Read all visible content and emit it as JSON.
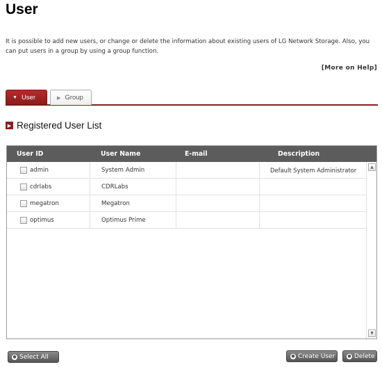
{
  "page": {
    "title": "User",
    "intro": "It is possible to add new users, or change or delete the information about existing users of LG Network Storage. Also, you can put users in a group by using a group function.",
    "help_link": "[More on Help]"
  },
  "tabs": [
    {
      "label": "User",
      "active": true
    },
    {
      "label": "Group",
      "active": false
    }
  ],
  "section": {
    "title": "Registered User List"
  },
  "table": {
    "columns": [
      "User ID",
      "User Name",
      "E-mail",
      "Description"
    ],
    "rows": [
      {
        "id": "admin",
        "name": "System Admin",
        "email": "",
        "description": "Default System Administrator"
      },
      {
        "id": "cdrlabs",
        "name": "CDRLabs",
        "email": "",
        "description": ""
      },
      {
        "id": "megatron",
        "name": "Megatron",
        "email": "",
        "description": ""
      },
      {
        "id": "optimus",
        "name": "Optimus Prime",
        "email": "",
        "description": ""
      }
    ]
  },
  "buttons": {
    "select_all": "Select All",
    "create_user": "Create User",
    "delete": "Delete"
  },
  "colors": {
    "accent": "#8b1c1c",
    "header_bg": "#5c5c5c",
    "button_bg": "#6e6e6e"
  }
}
